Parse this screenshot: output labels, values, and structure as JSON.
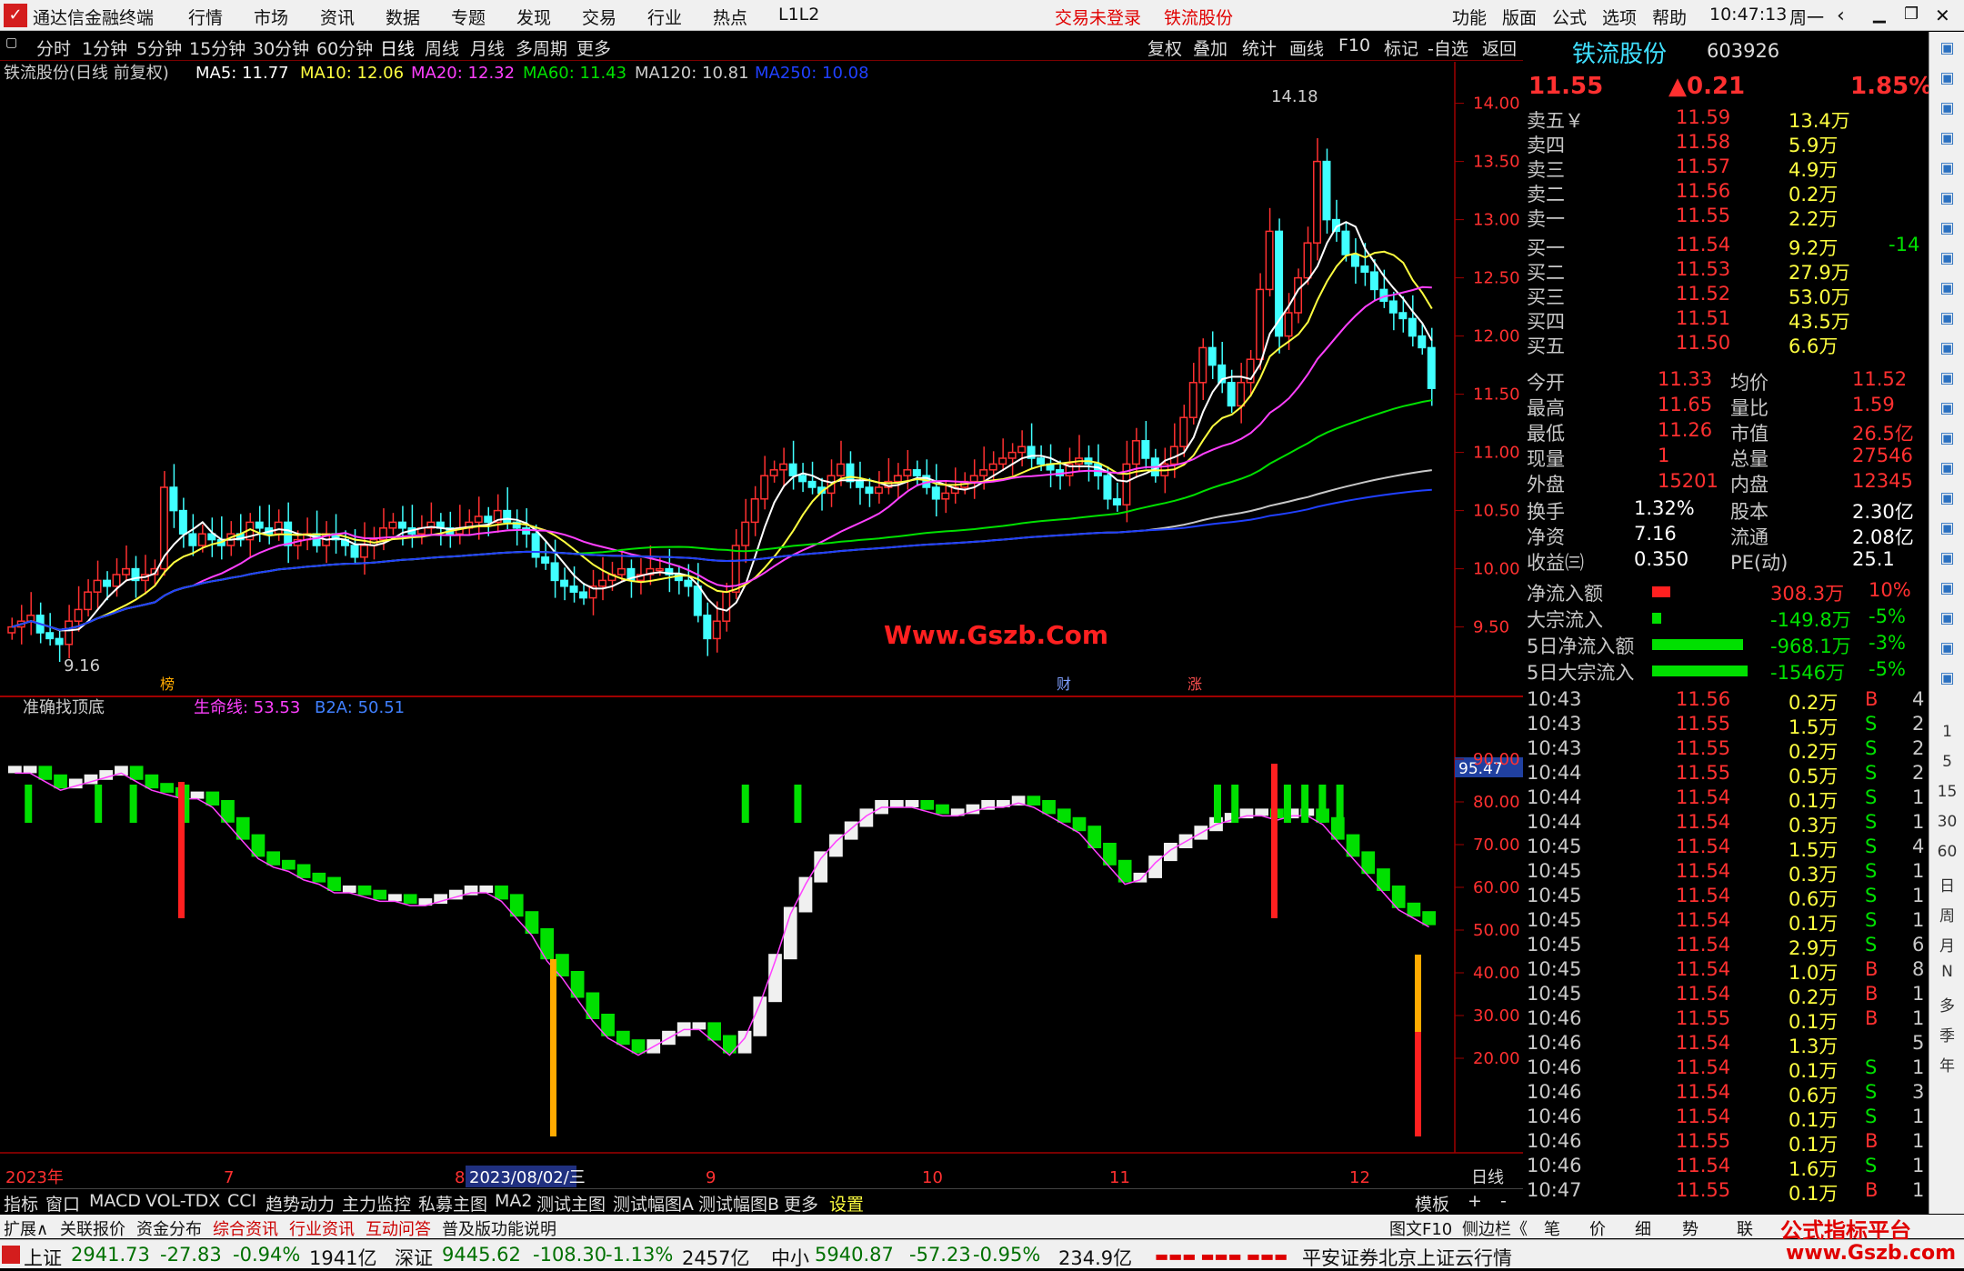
{
  "titlebar": {
    "app_name": "通达信金融终端",
    "menus": [
      "行情",
      "市场",
      "资讯",
      "数据",
      "专题",
      "发现",
      "交易",
      "行业",
      "热点",
      "L1L2"
    ],
    "notice": "交易未登录",
    "stock_name": "铁流股份",
    "right_menus": [
      "功能",
      "版面",
      "公式",
      "选项",
      "帮助"
    ],
    "time": "10:47:13",
    "weekday": "周一"
  },
  "period_bar": {
    "items": [
      "分时",
      "1分钟",
      "5分钟",
      "15分钟",
      "30分钟",
      "60分钟",
      "日线",
      "周线",
      "月线",
      "多周期",
      "更多"
    ],
    "active": "日线",
    "right_items": [
      "复权",
      "叠加",
      "统计",
      "画线",
      "F10",
      "标记",
      "-自选",
      "返回"
    ]
  },
  "ma_legend": {
    "title": "铁流股份(日线 前复权)",
    "ma5": "MA5: 11.77",
    "ma10": "MA10: 12.06",
    "ma20": "MA20: 12.32",
    "ma60": "MA60: 11.43",
    "ma120": "MA120: 10.81",
    "ma250": "MA250: 10.08"
  },
  "price_axis": [
    "14.00",
    "13.50",
    "13.00",
    "12.50",
    "12.00",
    "11.50",
    "11.00",
    "10.50",
    "10.00",
    "9.50"
  ],
  "high_label": "14.18",
  "low_label": "9.16",
  "watermark": "Www.Gszb.Com",
  "event_tags": [
    "榜",
    "财",
    "涨"
  ],
  "indicator": {
    "title": "准确找顶底",
    "life_line": "生命线: 53.53",
    "b2a": "B2A: 50.51",
    "marker": "95.47",
    "axis": [
      "90.00",
      "80.00",
      "70.00",
      "60.00",
      "50.00",
      "40.00",
      "30.00",
      "20.00"
    ]
  },
  "date_axis": {
    "labels": [
      "2023年",
      "7",
      "8",
      "9",
      "10",
      "11",
      "12"
    ],
    "cursor": "2023/08/02/三",
    "period": "日线"
  },
  "quote": {
    "name": "铁流股份",
    "code": "603926",
    "price": "11.55",
    "change": "▲0.21",
    "pct": "1.85%",
    "asks": [
      [
        "卖五￥",
        "11.59",
        "13.4万"
      ],
      [
        "卖四",
        "11.58",
        "5.9万"
      ],
      [
        "卖三",
        "11.57",
        "4.9万"
      ],
      [
        "卖二",
        "11.56",
        "0.2万"
      ],
      [
        "卖一",
        "11.55",
        "2.2万"
      ]
    ],
    "bids": [
      [
        "买一",
        "11.54",
        "9.2万",
        "-14"
      ],
      [
        "买二",
        "11.53",
        "27.9万",
        ""
      ],
      [
        "买三",
        "11.52",
        "53.0万",
        ""
      ],
      [
        "买四",
        "11.51",
        "43.5万",
        ""
      ],
      [
        "买五",
        "11.50",
        "6.6万",
        ""
      ]
    ],
    "stats": [
      [
        "今开",
        "11.33",
        "均价",
        "11.52"
      ],
      [
        "最高",
        "11.65",
        "量比",
        "1.59"
      ],
      [
        "最低",
        "11.26",
        "市值",
        "26.5亿"
      ],
      [
        "现量",
        "1",
        "总量",
        "27546"
      ],
      [
        "外盘",
        "15201",
        "内盘",
        "12345"
      ]
    ],
    "stats2": [
      [
        "换手",
        "1.32%",
        "股本",
        "2.30亿"
      ],
      [
        "净资",
        "7.16",
        "流通",
        "2.08亿"
      ],
      [
        "收益㈢",
        "0.350",
        "PE(动)",
        "25.1"
      ]
    ],
    "flows": [
      [
        "净流入额",
        "308.3万",
        "10%"
      ],
      [
        "大宗流入",
        "-149.8万",
        "-5%"
      ],
      [
        "5日净流入额",
        "-968.1万",
        "-3%"
      ],
      [
        "5日大宗流入",
        "-1546万",
        "-5%"
      ]
    ],
    "ticks": [
      [
        "10:43",
        "11.56",
        "0.2万",
        "B",
        "4"
      ],
      [
        "10:43",
        "11.55",
        "1.5万",
        "S",
        "2"
      ],
      [
        "10:43",
        "11.55",
        "0.2万",
        "S",
        "2"
      ],
      [
        "10:44",
        "11.55",
        "0.5万",
        "S",
        "2"
      ],
      [
        "10:44",
        "11.54",
        "0.1万",
        "S",
        "1"
      ],
      [
        "10:44",
        "11.54",
        "0.3万",
        "S",
        "1"
      ],
      [
        "10:45",
        "11.54",
        "1.5万",
        "S",
        "4"
      ],
      [
        "10:45",
        "11.54",
        "0.3万",
        "S",
        "1"
      ],
      [
        "10:45",
        "11.54",
        "0.6万",
        "S",
        "1"
      ],
      [
        "10:45",
        "11.54",
        "0.1万",
        "S",
        "1"
      ],
      [
        "10:45",
        "11.54",
        "2.9万",
        "S",
        "6"
      ],
      [
        "10:45",
        "11.54",
        "1.0万",
        "B",
        "8"
      ],
      [
        "10:45",
        "11.54",
        "0.2万",
        "B",
        "1"
      ],
      [
        "10:46",
        "11.55",
        "0.1万",
        "B",
        "1"
      ],
      [
        "10:46",
        "11.54",
        "1.3万",
        "",
        "5"
      ],
      [
        "10:46",
        "11.54",
        "0.1万",
        "S",
        "1"
      ],
      [
        "10:46",
        "11.54",
        "0.6万",
        "S",
        "3"
      ],
      [
        "10:46",
        "11.54",
        "0.1万",
        "S",
        "1"
      ],
      [
        "10:46",
        "11.55",
        "0.1万",
        "B",
        "1"
      ],
      [
        "10:46",
        "11.54",
        "1.6万",
        "S",
        "1"
      ],
      [
        "10:47",
        "11.55",
        "0.1万",
        "B",
        "1"
      ]
    ]
  },
  "right_toolbar": [
    "1",
    "5",
    "15",
    "30",
    "60",
    "日",
    "周",
    "月",
    "N",
    "多",
    "季",
    "年"
  ],
  "bottom_tabs": [
    "指标",
    "窗口",
    "MACD",
    "VOL-TDX",
    "CCI",
    "趋势动力",
    "主力监控",
    "私募主图",
    "MA2",
    "测试主图",
    "测试幅图A",
    "测试幅图B",
    "更多",
    "设置"
  ],
  "bottom_right": [
    "模板",
    "+",
    "-"
  ],
  "tabs2": [
    "扩展∧",
    "关联报价",
    "资金分布",
    "综合资讯",
    "行业资讯",
    "互动问答",
    "普及版功能说明"
  ],
  "tabs2_right": [
    "图文F10",
    "侧边栏《",
    "笔",
    "价",
    "细",
    "势",
    "联"
  ],
  "brand": "公式指标平台",
  "brand_url": "www.Gszb.com",
  "status": {
    "sh_name": "上证",
    "sh": "2941.73",
    "sh_chg": "-27.83",
    "sh_pct": "-0.94%",
    "sh_amt": "1941亿",
    "sz_name": "深证",
    "sz": "9445.62",
    "sz_chg": "-108.30",
    "sz_pct": "-1.13%",
    "sz_amt": "2457亿",
    "zx_name": "中小",
    "zx": "5940.87",
    "zx_chg": "-57.23",
    "zx_pct": "-0.95%",
    "zx_amt": "234.9亿",
    "broker": "平安证券北京上证云行情"
  },
  "colors": {
    "up": "#ff3030",
    "down": "#40ffff",
    "ma5": "#ffffff",
    "ma10": "#ffff40",
    "ma20": "#ff40ff",
    "ma60": "#00e000",
    "ma120": "#c8c8c8",
    "ma250": "#2040ff"
  },
  "chart_data": {
    "type": "candlestick",
    "ylim": [
      9.2,
      14.2
    ],
    "close": [
      9.5,
      9.55,
      9.6,
      9.45,
      9.4,
      9.35,
      9.55,
      9.65,
      9.8,
      9.9,
      9.85,
      9.95,
      10.0,
      9.9,
      9.95,
      10.0,
      10.7,
      10.5,
      10.3,
      10.2,
      10.3,
      10.25,
      10.2,
      10.3,
      10.25,
      10.4,
      10.35,
      10.3,
      10.4,
      10.2,
      10.25,
      10.3,
      10.2,
      10.3,
      10.25,
      10.2,
      10.1,
      10.2,
      10.25,
      10.35,
      10.4,
      10.35,
      10.3,
      10.35,
      10.4,
      10.35,
      10.3,
      10.35,
      10.4,
      10.45,
      10.4,
      10.5,
      10.4,
      10.35,
      10.3,
      10.1,
      10.05,
      9.9,
      9.85,
      9.8,
      9.75,
      9.85,
      9.9,
      9.95,
      10.0,
      9.9,
      9.95,
      10.0,
      10.0,
      9.95,
      9.9,
      9.85,
      9.6,
      9.4,
      9.55,
      9.8,
      10.2,
      10.4,
      10.6,
      10.8,
      10.85,
      10.9,
      10.8,
      10.75,
      10.7,
      10.65,
      10.8,
      10.9,
      10.75,
      10.7,
      10.65,
      10.7,
      10.75,
      10.8,
      10.85,
      10.8,
      10.7,
      10.6,
      10.65,
      10.7,
      10.75,
      10.8,
      10.85,
      10.9,
      10.95,
      11.0,
      11.05,
      10.95,
      10.9,
      10.85,
      10.8,
      10.9,
      10.95,
      10.9,
      10.8,
      10.6,
      10.55,
      10.9,
      11.1,
      10.95,
      10.8,
      10.9,
      11.05,
      11.3,
      11.6,
      11.9,
      11.75,
      11.6,
      11.4,
      11.6,
      11.8,
      12.4,
      12.9,
      12.0,
      12.2,
      12.5,
      12.8,
      13.5,
      13.0,
      12.9,
      12.7,
      12.6,
      12.55,
      12.4,
      12.3,
      12.2,
      12.15,
      12.0,
      11.9,
      11.55
    ]
  },
  "indicator_data": {
    "ylim": [
      0,
      100
    ],
    "life": [
      88,
      88,
      86,
      84,
      85,
      86,
      87,
      88,
      86,
      84,
      83,
      82,
      82,
      80,
      76,
      72,
      68,
      66,
      65,
      63,
      62,
      60,
      60,
      59,
      58,
      58,
      57,
      57,
      58,
      59,
      60,
      60,
      58,
      54,
      50,
      44,
      40,
      35,
      30,
      26,
      24,
      22,
      24,
      26,
      28,
      28,
      25,
      22,
      26,
      34,
      44,
      55,
      62,
      68,
      72,
      75,
      78,
      80,
      80,
      80,
      79,
      78,
      78,
      79,
      80,
      80,
      81,
      80,
      78,
      76,
      74,
      70,
      66,
      62,
      63,
      67,
      70,
      72,
      74,
      76,
      77,
      78,
      78,
      77,
      78,
      78,
      76,
      72,
      68,
      64,
      60,
      56,
      54,
      52
    ]
  }
}
